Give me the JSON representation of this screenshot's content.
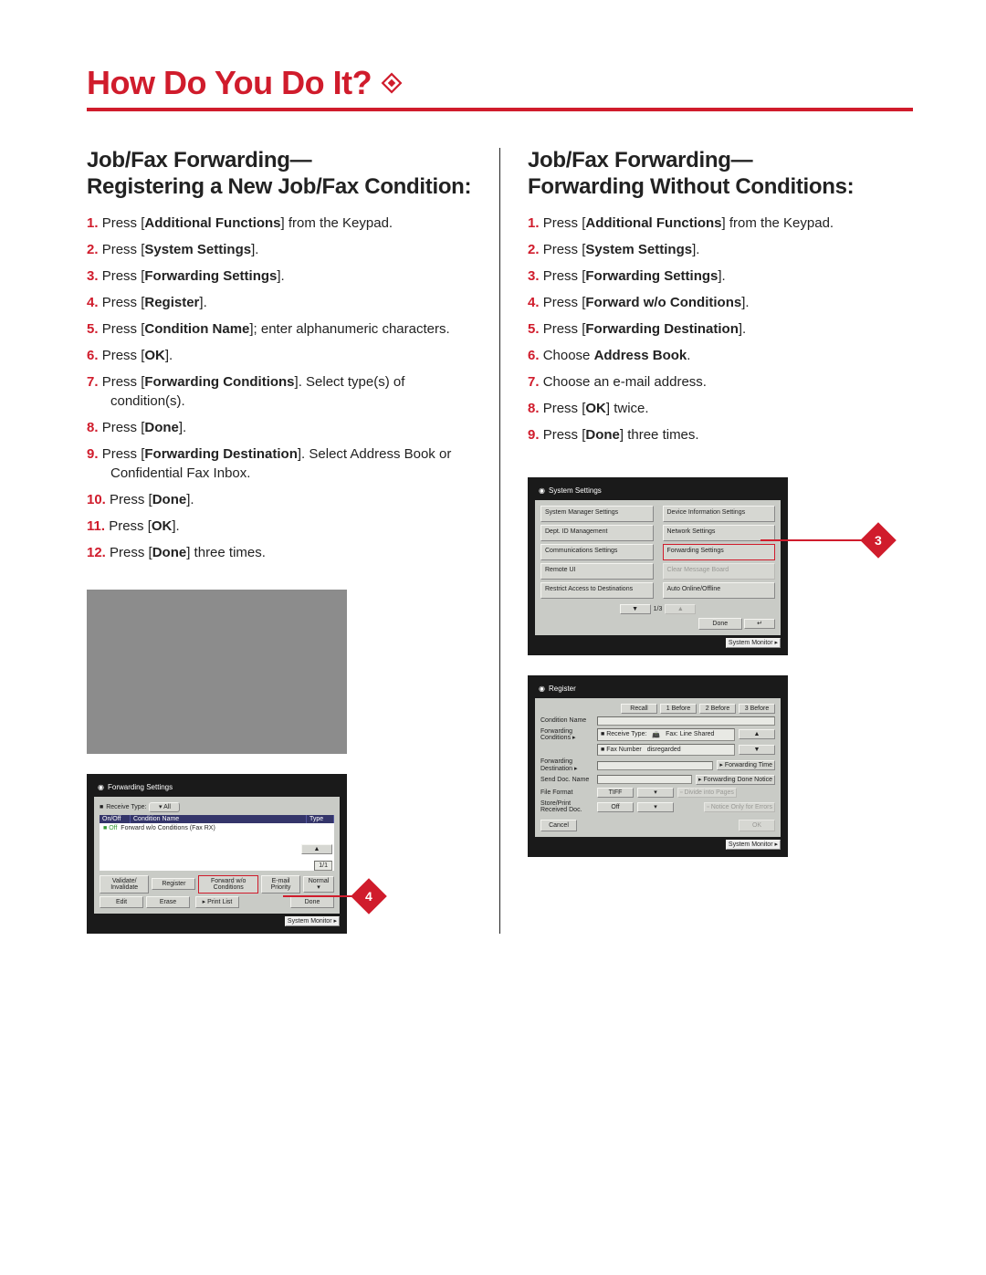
{
  "page": {
    "title": "How Do You Do It?"
  },
  "left": {
    "heading_l1": "Job/Fax Forwarding—",
    "heading_l2": "Registering a New Job/Fax Condition:",
    "steps": [
      {
        "n": "1.",
        "pre": "Press [",
        "bold": "Additional Functions",
        "post": "] from the Keypad."
      },
      {
        "n": "2.",
        "pre": "Press [",
        "bold": "System Settings",
        "post": "]."
      },
      {
        "n": "3.",
        "pre": "Press [",
        "bold": "Forwarding Settings",
        "post": "]."
      },
      {
        "n": "4.",
        "pre": "Press [",
        "bold": "Register",
        "post": "]."
      },
      {
        "n": "5.",
        "pre": "Press [",
        "bold": "Condition Name",
        "post": "]; enter alphanumeric characters."
      },
      {
        "n": "6.",
        "pre": "Press [",
        "bold": "OK",
        "post": "]."
      },
      {
        "n": "7.",
        "pre": "Press [",
        "bold": "Forwarding Conditions",
        "post": "]. Select type(s) of condition(s)."
      },
      {
        "n": "8.",
        "pre": "Press [",
        "bold": "Done",
        "post": "]."
      },
      {
        "n": "9.",
        "pre": "Press [",
        "bold": "Forwarding Destination",
        "post": "]. Select Address Book or Confidential Fax Inbox."
      },
      {
        "n": "10.",
        "pre": "Press [",
        "bold": "Done",
        "post": "]."
      },
      {
        "n": "11.",
        "pre": "Press [",
        "bold": "OK",
        "post": "]."
      },
      {
        "n": "12.",
        "pre": "Press [",
        "bold": "Done",
        "post": "] three times."
      }
    ],
    "callout": "4",
    "panelB": {
      "title": "Forwarding Settings",
      "receive_type_label": "Receive Type:",
      "receive_type_val": "All",
      "col_onoff": "On/Off",
      "col_cond": "Condition Name",
      "col_type": "Type",
      "entry_status": "Off",
      "entry_text": "Forward w/o Conditions (Fax RX)",
      "page": "1/1",
      "buttons": {
        "validate": "Validate/ Invalidate",
        "register": "Register",
        "fwd": "Forward w/o Conditions",
        "email": "E-mail Priority",
        "normal": "Normal",
        "edit": "Edit",
        "erase": "Erase",
        "print": "Print List",
        "done": "Done"
      },
      "sysmon": "System Monitor"
    }
  },
  "right": {
    "heading_l1": "Job/Fax Forwarding—",
    "heading_l2": "Forwarding Without Conditions:",
    "steps": [
      {
        "n": "1.",
        "pre": "Press [",
        "bold": "Additional Functions",
        "post": "] from the Keypad."
      },
      {
        "n": "2.",
        "pre": "Press [",
        "bold": "System Settings",
        "post": "]."
      },
      {
        "n": "3.",
        "pre": "Press [",
        "bold": "Forwarding Settings",
        "post": "]."
      },
      {
        "n": "4.",
        "pre": "Press [",
        "bold": "Forward w/o Conditions",
        "post": "]."
      },
      {
        "n": "5.",
        "pre": "Press [",
        "bold": "Forwarding Destination",
        "post": "]."
      },
      {
        "n": "6.",
        "pre": "Choose ",
        "bold": "Address Book",
        "post": "."
      },
      {
        "n": "7.",
        "pre": "Choose an e-mail address.",
        "bold": "",
        "post": ""
      },
      {
        "n": "8.",
        "pre": "Press [",
        "bold": "OK",
        "post": "] twice."
      },
      {
        "n": "9.",
        "pre": "Press [",
        "bold": "Done",
        "post": "] three times."
      }
    ],
    "callout": "3",
    "panelA": {
      "title": "System Settings",
      "items_left": [
        "System Manager Settings",
        "Dept. ID Management",
        "Communications Settings",
        "Remote UI",
        "Restrict Access to Destinations"
      ],
      "items_right": [
        "Device Information Settings",
        "Network Settings",
        "Forwarding Settings",
        "Clear Message Board",
        "Auto Online/Offline"
      ],
      "pager": "1/3",
      "done": "Done",
      "sysmon": "System Monitor"
    },
    "panelC": {
      "title": "Register",
      "top_buttons": [
        "Recall",
        "1 Before",
        "2 Before",
        "3 Before"
      ],
      "rows": {
        "cond": "Condition Name",
        "fwdcond": "Forwarding Conditions",
        "rc_type_lbl": "Receive Type:",
        "rc_type_val": "Fax: Line Shared",
        "faxno_lbl": "Fax Number",
        "faxno_val": "disregarded",
        "fwddest": "Forwarding Destination",
        "fwdtime": "Forwarding Time",
        "senddoc": "Send Doc. Name",
        "fwddone": "Forwarding Done Notice",
        "fileformat": "File Format",
        "ff_val": "TIFF",
        "divide": "Divide into Pages",
        "store": "Store/Print Received Doc.",
        "store_val": "Off",
        "notice": "Notice Only for Errors"
      },
      "cancel": "Cancel",
      "ok": "OK",
      "sysmon": "System Monitor"
    }
  }
}
